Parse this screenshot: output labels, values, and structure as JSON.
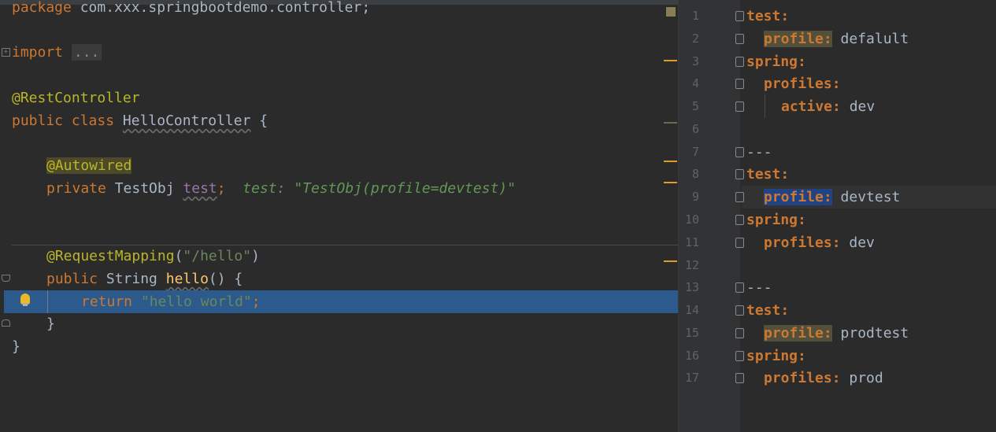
{
  "java_editor": {
    "lines": {
      "package": {
        "kw": "package",
        "rest": " com.xxx.springbootdemo.controller;"
      },
      "import": {
        "kw": "import",
        "folded": "..."
      },
      "annotation_rest": "@RestController",
      "class_decl": {
        "kw": "public class",
        "name": "HelloController",
        "rest": " {"
      },
      "autowired": "@Autowired",
      "field": {
        "kw": "private",
        "type": " TestObj ",
        "name": "test",
        "semi": ";",
        "hint": "test: \"TestObj(profile=devtest)\""
      },
      "mapping": {
        "ann": "@RequestMapping",
        "open": "(",
        "arg": "\"/hello\"",
        "close": ")"
      },
      "method": {
        "kw": "public",
        "type": " String ",
        "name": "hello",
        "rest": "() {"
      },
      "return_line": {
        "kw": "return",
        "str": "\"hello world\"",
        "semi": ";"
      },
      "close_method": "}",
      "close_class": "}"
    }
  },
  "yaml_editor": {
    "lines": [
      {
        "n": "1",
        "indent": "",
        "key": "test:",
        "value": ""
      },
      {
        "n": "2",
        "indent": "  ",
        "key": "profile:",
        "value": " defalult"
      },
      {
        "n": "3",
        "indent": "",
        "key": "spring:",
        "value": ""
      },
      {
        "n": "4",
        "indent": "  ",
        "key": "profiles:",
        "value": ""
      },
      {
        "n": "5",
        "indent": "    ",
        "key": "active:",
        "value": " dev"
      },
      {
        "n": "6",
        "indent": "",
        "key": "",
        "value": ""
      },
      {
        "n": "7",
        "indent": "",
        "key": "",
        "value": "---"
      },
      {
        "n": "8",
        "indent": "",
        "key": "test:",
        "value": ""
      },
      {
        "n": "9",
        "indent": "  ",
        "key": "profile:",
        "value": " devtest"
      },
      {
        "n": "10",
        "indent": "",
        "key": "spring:",
        "value": ""
      },
      {
        "n": "11",
        "indent": "  ",
        "key": "profiles:",
        "value": " dev"
      },
      {
        "n": "12",
        "indent": "",
        "key": "",
        "value": ""
      },
      {
        "n": "13",
        "indent": "",
        "key": "",
        "value": "---"
      },
      {
        "n": "14",
        "indent": "",
        "key": "test:",
        "value": ""
      },
      {
        "n": "15",
        "indent": "  ",
        "key": "profile:",
        "value": " prodtest"
      },
      {
        "n": "16",
        "indent": "",
        "key": "spring:",
        "value": ""
      },
      {
        "n": "17",
        "indent": "  ",
        "key": "profiles:",
        "value": " prod"
      }
    ]
  },
  "colors": {
    "background": "#2b2b2b",
    "keyword": "#cc7832",
    "annotation": "#bbb529",
    "string": "#6a8759",
    "selection": "#2d5a8c",
    "gutter": "#313335"
  }
}
